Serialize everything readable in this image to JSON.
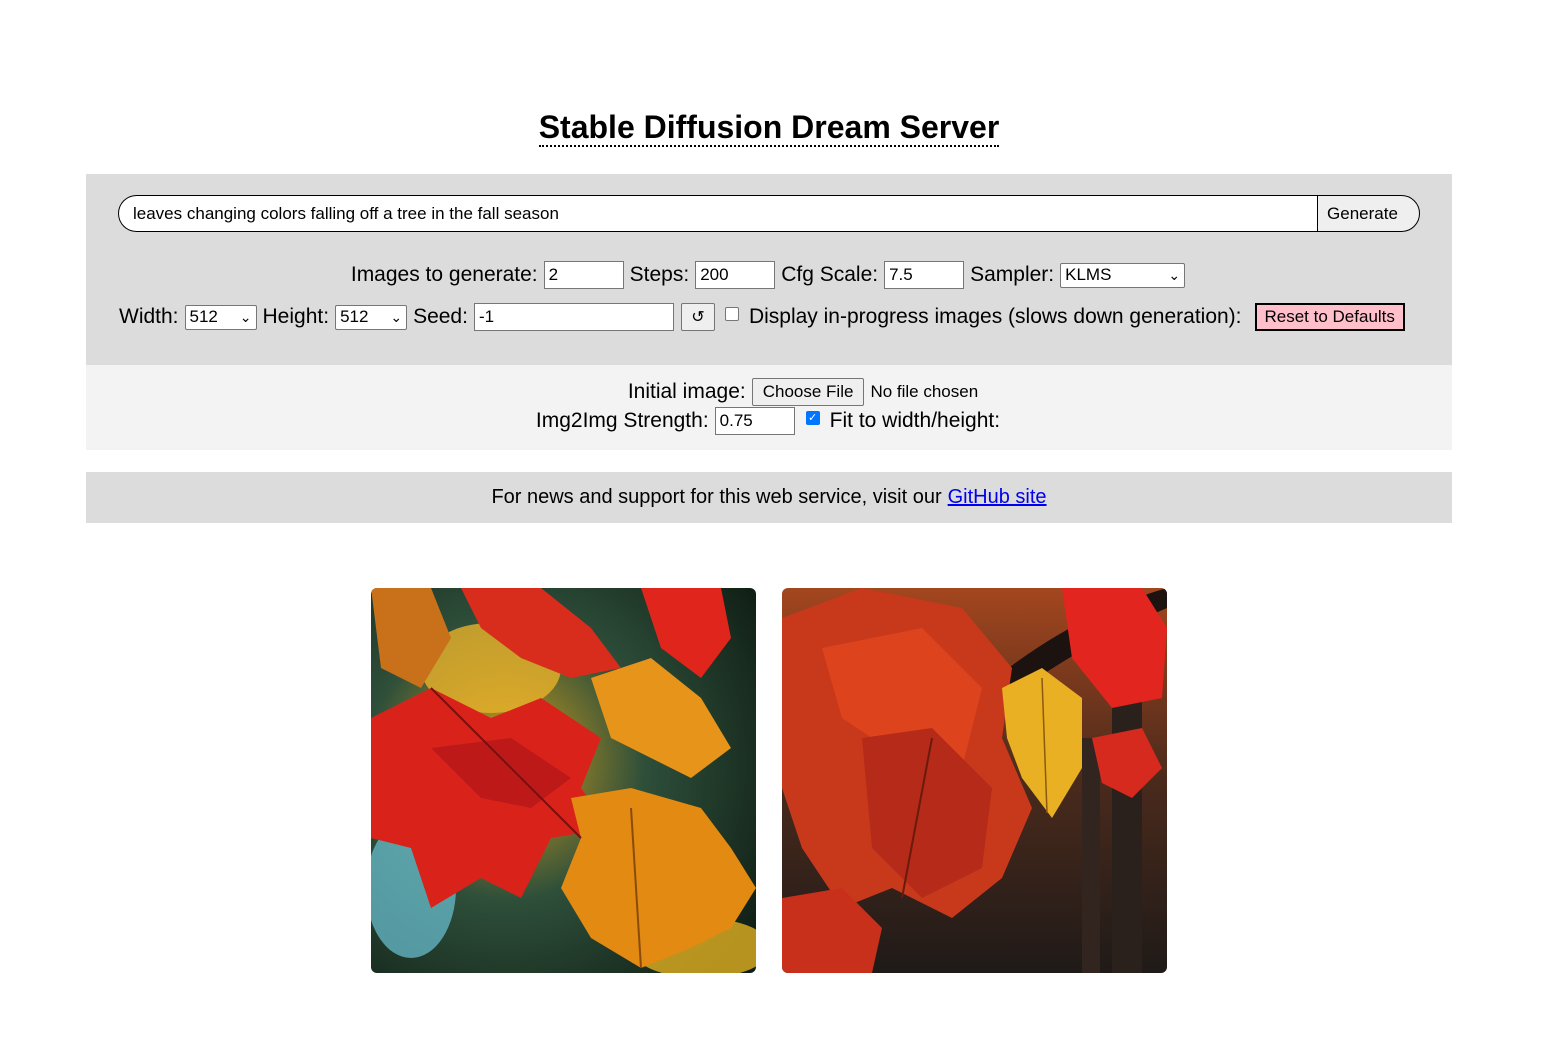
{
  "header": {
    "title": "Stable Diffusion Dream Server"
  },
  "prompt": {
    "value": "leaves changing colors falling off a tree in the fall season",
    "generate_label": "Generate"
  },
  "options": {
    "images_label": "Images to generate:",
    "images_value": "2",
    "steps_label": "Steps:",
    "steps_value": "200",
    "cfg_label": "Cfg Scale:",
    "cfg_value": "7.5",
    "sampler_label": "Sampler:",
    "sampler_value": "KLMS",
    "width_label": "Width:",
    "width_value": "512",
    "height_label": "Height:",
    "height_value": "512",
    "seed_label": "Seed:",
    "seed_value": "-1",
    "seed_reset_glyph": "↺",
    "progress_checked": false,
    "progress_label": "Display in-progress images (slows down generation):",
    "reset_label": "Reset to Defaults"
  },
  "img2img": {
    "initial_label": "Initial image:",
    "choose_file_label": "Choose File",
    "no_file_text": "No file chosen",
    "strength_label": "Img2Img Strength:",
    "strength_value": "0.75",
    "fit_checked": true,
    "fit_label": "Fit to width/height:"
  },
  "news": {
    "text": "For news and support for this web service, visit our",
    "link_text": "GitHub site"
  },
  "results": {
    "images": [
      {
        "subject": "red and orange autumn maple leaves with green blurred background"
      },
      {
        "subject": "red autumn leaves on dark branch with yellow leaf, forest background"
      }
    ]
  },
  "colors": {
    "panel_gray": "#dcdcdc",
    "panel_light": "#f3f3f3",
    "reset_pink": "#ffc0cb",
    "link_blue": "#0000ee",
    "checkbox_blue": "#0075ff"
  }
}
